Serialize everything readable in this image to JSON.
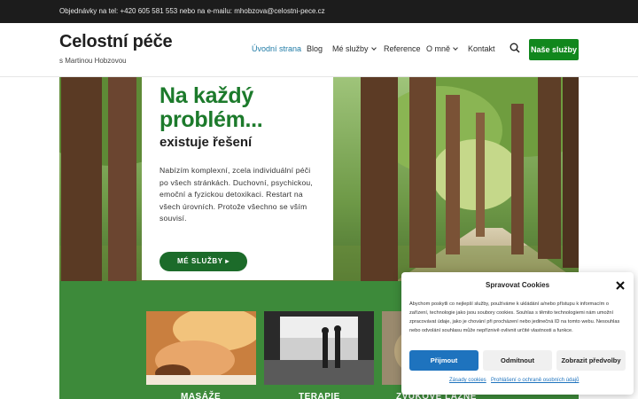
{
  "topbar": {
    "contact": "Objednávky na tel: +420 605 581 553 nebo na e-mailu: mhobzova@celostni-pece.cz"
  },
  "header": {
    "title": "Celostní péče",
    "subtitle": "s Martinou Hobzovou",
    "nav": [
      {
        "label": "Úvodní strana",
        "active": true
      },
      {
        "label": "Blog"
      },
      {
        "label": "Mé služby",
        "dropdown": true
      },
      {
        "label": "Reference"
      },
      {
        "label": "O mně",
        "dropdown": true
      },
      {
        "label": "Kontakt"
      }
    ],
    "cta": "Naše služby"
  },
  "hero": {
    "heading": "Na každý problém...",
    "subheading": "existuje řešení",
    "text": "Nabízím komplexní, zcela individuální péči po všech stránkách. Duchovní, psychickou, emoční a fyzickou detoxikaci. Restart na všech úrovních. Protože všechno se vším souvisí.",
    "button": "MÉ SLUŽBY ▸"
  },
  "services": [
    {
      "title": "MASÁŽE"
    },
    {
      "title": "TERAPIE"
    },
    {
      "title": "ZVUKOVÉ LÁZNĚ"
    }
  ],
  "cookie": {
    "title": "Spravovat Cookies",
    "text": "Abychom poskytli co nejlepší služby, používáme k ukládání a/nebo přístupu k informacím o zařízení, technologie jako jsou soubory cookies. Souhlas s těmito technologiemi nám umožní zpracovávat údaje, jako je chování při procházení nebo jedinečná ID na tomto webu. Nesouhlas nebo odvolání souhlasu může nepříznivě ovlivnit určité vlastnosti a funkce.",
    "accept": "Přijmout",
    "deny": "Odmítnout",
    "preferences": "Zobrazit předvolby",
    "link_policy": "Zásady cookies",
    "link_privacy": "Prohlášení o ochraně osobních údajů"
  },
  "colors": {
    "brand_green": "#11871d",
    "heading_green": "#1c7a2b",
    "accept_blue": "#1e73be",
    "services_bg": "#3d8a3a"
  }
}
